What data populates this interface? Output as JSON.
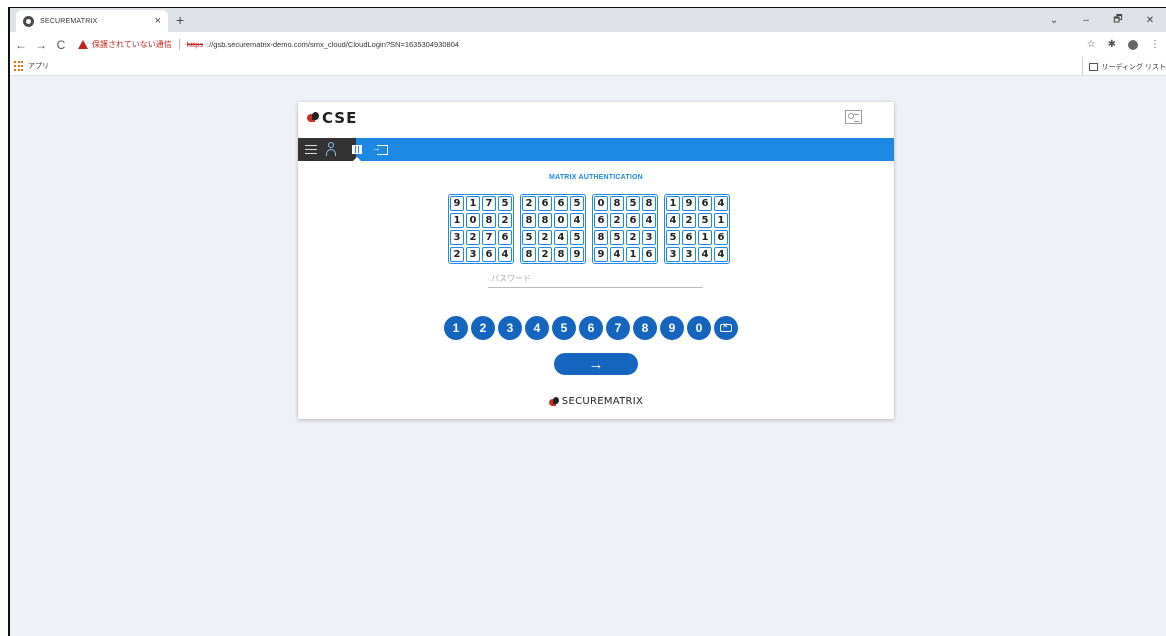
{
  "browser": {
    "tab_title": "SECUREMATRIX",
    "tab_close": "×",
    "new_tab": "+",
    "window_controls": [
      "⌄",
      "–",
      "🗗",
      "✕"
    ],
    "nav": {
      "back": "←",
      "forward": "→",
      "reload": "C"
    },
    "security_warning": "保護されていない通信",
    "url_scheme": "https",
    "url_rest": "://gsb.securematrix-demo.com/smx_cloud/CloudLogin?SN=1635304930804",
    "toolbar_icons": [
      "star-icon",
      "extensions-icon",
      "profile-icon",
      "menu-icon"
    ],
    "bookmarks": {
      "apps_label": "アプリ",
      "reading_list_label": "リーディング リスト"
    }
  },
  "login": {
    "brand": "CSE",
    "auth_title": "MATRIX AUTHENTICATION",
    "matrix": [
      [
        [
          "9",
          "1",
          "7",
          "5"
        ],
        [
          "1",
          "0",
          "8",
          "2"
        ],
        [
          "3",
          "2",
          "7",
          "6"
        ],
        [
          "2",
          "3",
          "6",
          "4"
        ]
      ],
      [
        [
          "2",
          "6",
          "6",
          "5"
        ],
        [
          "8",
          "8",
          "0",
          "4"
        ],
        [
          "5",
          "2",
          "4",
          "5"
        ],
        [
          "8",
          "2",
          "8",
          "9"
        ]
      ],
      [
        [
          "0",
          "8",
          "5",
          "8"
        ],
        [
          "6",
          "2",
          "6",
          "4"
        ],
        [
          "8",
          "5",
          "2",
          "3"
        ],
        [
          "9",
          "4",
          "1",
          "6"
        ]
      ],
      [
        [
          "1",
          "9",
          "6",
          "4"
        ],
        [
          "4",
          "2",
          "5",
          "1"
        ],
        [
          "5",
          "6",
          "1",
          "6"
        ],
        [
          "3",
          "3",
          "4",
          "4"
        ]
      ]
    ],
    "password_placeholder": "パスワード",
    "keypad": [
      "1",
      "2",
      "3",
      "4",
      "5",
      "6",
      "7",
      "8",
      "9",
      "0"
    ],
    "submit": "→",
    "footer_brand": "SECUREMATRIX"
  },
  "colors": {
    "accent": "#1e88e5",
    "button": "#1565c0",
    "warning": "#c5221f",
    "nav_dark": "#333333"
  }
}
